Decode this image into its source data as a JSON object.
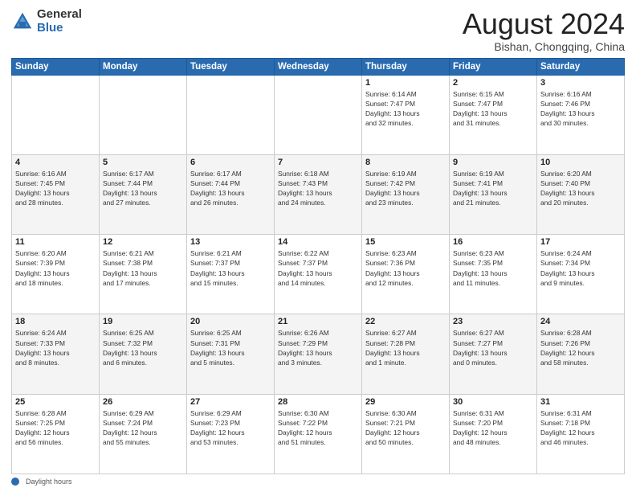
{
  "logo": {
    "general": "General",
    "blue": "Blue"
  },
  "title": "August 2024",
  "subtitle": "Bishan, Chongqing, China",
  "headers": [
    "Sunday",
    "Monday",
    "Tuesday",
    "Wednesday",
    "Thursday",
    "Friday",
    "Saturday"
  ],
  "weeks": [
    [
      {
        "day": "",
        "info": ""
      },
      {
        "day": "",
        "info": ""
      },
      {
        "day": "",
        "info": ""
      },
      {
        "day": "",
        "info": ""
      },
      {
        "day": "1",
        "info": "Sunrise: 6:14 AM\nSunset: 7:47 PM\nDaylight: 13 hours\nand 32 minutes."
      },
      {
        "day": "2",
        "info": "Sunrise: 6:15 AM\nSunset: 7:47 PM\nDaylight: 13 hours\nand 31 minutes."
      },
      {
        "day": "3",
        "info": "Sunrise: 6:16 AM\nSunset: 7:46 PM\nDaylight: 13 hours\nand 30 minutes."
      }
    ],
    [
      {
        "day": "4",
        "info": "Sunrise: 6:16 AM\nSunset: 7:45 PM\nDaylight: 13 hours\nand 28 minutes."
      },
      {
        "day": "5",
        "info": "Sunrise: 6:17 AM\nSunset: 7:44 PM\nDaylight: 13 hours\nand 27 minutes."
      },
      {
        "day": "6",
        "info": "Sunrise: 6:17 AM\nSunset: 7:44 PM\nDaylight: 13 hours\nand 26 minutes."
      },
      {
        "day": "7",
        "info": "Sunrise: 6:18 AM\nSunset: 7:43 PM\nDaylight: 13 hours\nand 24 minutes."
      },
      {
        "day": "8",
        "info": "Sunrise: 6:19 AM\nSunset: 7:42 PM\nDaylight: 13 hours\nand 23 minutes."
      },
      {
        "day": "9",
        "info": "Sunrise: 6:19 AM\nSunset: 7:41 PM\nDaylight: 13 hours\nand 21 minutes."
      },
      {
        "day": "10",
        "info": "Sunrise: 6:20 AM\nSunset: 7:40 PM\nDaylight: 13 hours\nand 20 minutes."
      }
    ],
    [
      {
        "day": "11",
        "info": "Sunrise: 6:20 AM\nSunset: 7:39 PM\nDaylight: 13 hours\nand 18 minutes."
      },
      {
        "day": "12",
        "info": "Sunrise: 6:21 AM\nSunset: 7:38 PM\nDaylight: 13 hours\nand 17 minutes."
      },
      {
        "day": "13",
        "info": "Sunrise: 6:21 AM\nSunset: 7:37 PM\nDaylight: 13 hours\nand 15 minutes."
      },
      {
        "day": "14",
        "info": "Sunrise: 6:22 AM\nSunset: 7:37 PM\nDaylight: 13 hours\nand 14 minutes."
      },
      {
        "day": "15",
        "info": "Sunrise: 6:23 AM\nSunset: 7:36 PM\nDaylight: 13 hours\nand 12 minutes."
      },
      {
        "day": "16",
        "info": "Sunrise: 6:23 AM\nSunset: 7:35 PM\nDaylight: 13 hours\nand 11 minutes."
      },
      {
        "day": "17",
        "info": "Sunrise: 6:24 AM\nSunset: 7:34 PM\nDaylight: 13 hours\nand 9 minutes."
      }
    ],
    [
      {
        "day": "18",
        "info": "Sunrise: 6:24 AM\nSunset: 7:33 PM\nDaylight: 13 hours\nand 8 minutes."
      },
      {
        "day": "19",
        "info": "Sunrise: 6:25 AM\nSunset: 7:32 PM\nDaylight: 13 hours\nand 6 minutes."
      },
      {
        "day": "20",
        "info": "Sunrise: 6:25 AM\nSunset: 7:31 PM\nDaylight: 13 hours\nand 5 minutes."
      },
      {
        "day": "21",
        "info": "Sunrise: 6:26 AM\nSunset: 7:29 PM\nDaylight: 13 hours\nand 3 minutes."
      },
      {
        "day": "22",
        "info": "Sunrise: 6:27 AM\nSunset: 7:28 PM\nDaylight: 13 hours\nand 1 minute."
      },
      {
        "day": "23",
        "info": "Sunrise: 6:27 AM\nSunset: 7:27 PM\nDaylight: 13 hours\nand 0 minutes."
      },
      {
        "day": "24",
        "info": "Sunrise: 6:28 AM\nSunset: 7:26 PM\nDaylight: 12 hours\nand 58 minutes."
      }
    ],
    [
      {
        "day": "25",
        "info": "Sunrise: 6:28 AM\nSunset: 7:25 PM\nDaylight: 12 hours\nand 56 minutes."
      },
      {
        "day": "26",
        "info": "Sunrise: 6:29 AM\nSunset: 7:24 PM\nDaylight: 12 hours\nand 55 minutes."
      },
      {
        "day": "27",
        "info": "Sunrise: 6:29 AM\nSunset: 7:23 PM\nDaylight: 12 hours\nand 53 minutes."
      },
      {
        "day": "28",
        "info": "Sunrise: 6:30 AM\nSunset: 7:22 PM\nDaylight: 12 hours\nand 51 minutes."
      },
      {
        "day": "29",
        "info": "Sunrise: 6:30 AM\nSunset: 7:21 PM\nDaylight: 12 hours\nand 50 minutes."
      },
      {
        "day": "30",
        "info": "Sunrise: 6:31 AM\nSunset: 7:20 PM\nDaylight: 12 hours\nand 48 minutes."
      },
      {
        "day": "31",
        "info": "Sunrise: 6:31 AM\nSunset: 7:18 PM\nDaylight: 12 hours\nand 46 minutes."
      }
    ]
  ],
  "footer": {
    "label": "Daylight hours"
  }
}
